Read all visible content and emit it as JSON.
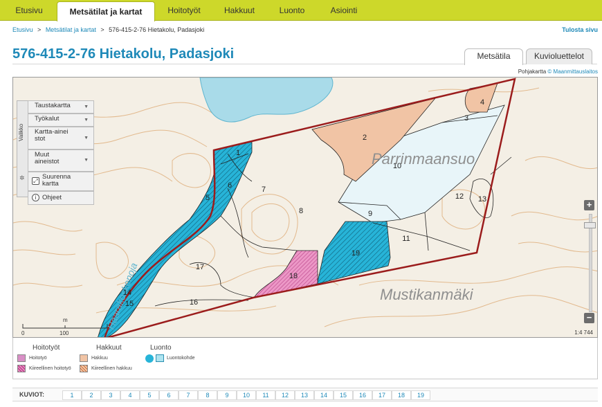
{
  "nav": {
    "tabs": [
      "Etusivu",
      "Metsätilat ja kartat",
      "Hoitotyöt",
      "Hakkuut",
      "Luonto",
      "Asiointi"
    ],
    "active_tab": "Metsätilat ja kartat"
  },
  "breadcrumb": {
    "home": "Etusivu",
    "section": "Metsätilat ja kartat",
    "current": "576-415-2-76 Hietakolu, Padasjoki",
    "separator": ">"
  },
  "print_link": "Tulosta sivu",
  "page_title": "576-415-2-76 Hietakolu, Padasjoki",
  "view_tabs": [
    "Metsätila",
    "Kuvioluettelot"
  ],
  "active_view_tab": "Metsätila",
  "basemap_credit": {
    "prefix": "Pohjakartta",
    "link": "© Maanmittauslaitos"
  },
  "map": {
    "menu_label": "Valikko",
    "tools": {
      "background_map": "Taustakartta",
      "tools": "Työkalut",
      "map_data": "Kartta-aineistot",
      "other_data": "Muut aineistot",
      "enlarge_map": "Suurenna kartta",
      "help": "Ohjeet"
    },
    "place_names": [
      "Parrinmaansuo",
      "Mustikanmäki",
      "Haarakoskenoja"
    ],
    "compartments": [
      "1",
      "2",
      "3",
      "4",
      "5",
      "6",
      "7",
      "8",
      "9",
      "10",
      "11",
      "12",
      "13",
      "14",
      "15",
      "16",
      "17",
      "18",
      "19"
    ],
    "scale": {
      "zero": "0",
      "mid": "100",
      "unit": "m"
    },
    "scale_ratio": "1:4 744",
    "zoom_in": "+",
    "zoom_out": "−"
  },
  "legend": {
    "groups": [
      {
        "title": "Hoitotyöt",
        "items": [
          "Hoitotyö",
          "Kiireellinen hoitotyö"
        ]
      },
      {
        "title": "Hakkuut",
        "items": [
          "Hakkuu",
          "Kiireellinen hakkuu"
        ]
      },
      {
        "title": "Luonto",
        "items": [
          "Luontokohde"
        ]
      }
    ]
  },
  "kuviot": {
    "label": "KUVIOT:",
    "numbers": [
      "1",
      "2",
      "3",
      "4",
      "5",
      "6",
      "7",
      "8",
      "9",
      "10",
      "11",
      "12",
      "13",
      "14",
      "15",
      "16",
      "17",
      "18",
      "19"
    ]
  },
  "colors": {
    "nav_bg": "#cdd82a",
    "accent": "#1e89b8",
    "boundary": "#9b1c1c",
    "hakkuu": "#f1c4a5",
    "hoito": "#e88bc0",
    "luonto": "#27b4d8",
    "water": "#a9dbe9"
  }
}
